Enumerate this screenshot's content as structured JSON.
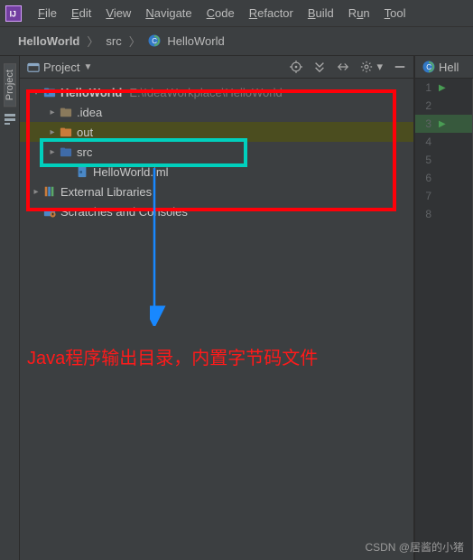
{
  "menu": {
    "items": [
      "File",
      "Edit",
      "View",
      "Navigate",
      "Code",
      "Refactor",
      "Build",
      "Run",
      "Tools"
    ]
  },
  "breadcrumb": {
    "project": "HelloWorld",
    "src": "src",
    "klass": "HelloWorld"
  },
  "pane": {
    "title": "Project"
  },
  "stripe": {
    "project": "Project"
  },
  "tree": {
    "root": {
      "name": "HelloWorld",
      "path": "E:\\IdeaWorkplace\\HelloWorld"
    },
    "idea": ".idea",
    "out": "out",
    "src": "src",
    "iml": "HelloWorld.iml",
    "ext": "External Libraries",
    "scratch": "Scratches and Consoles"
  },
  "editor": {
    "tab": "Hell",
    "lines": [
      1,
      2,
      3,
      4,
      5,
      6,
      7,
      8
    ],
    "runnable": [
      1,
      3
    ],
    "highlighted": 3
  },
  "annotation": {
    "text": "Java程序输出目录，内置字节码文件"
  },
  "watermark": "CSDN @居酱的小猪"
}
